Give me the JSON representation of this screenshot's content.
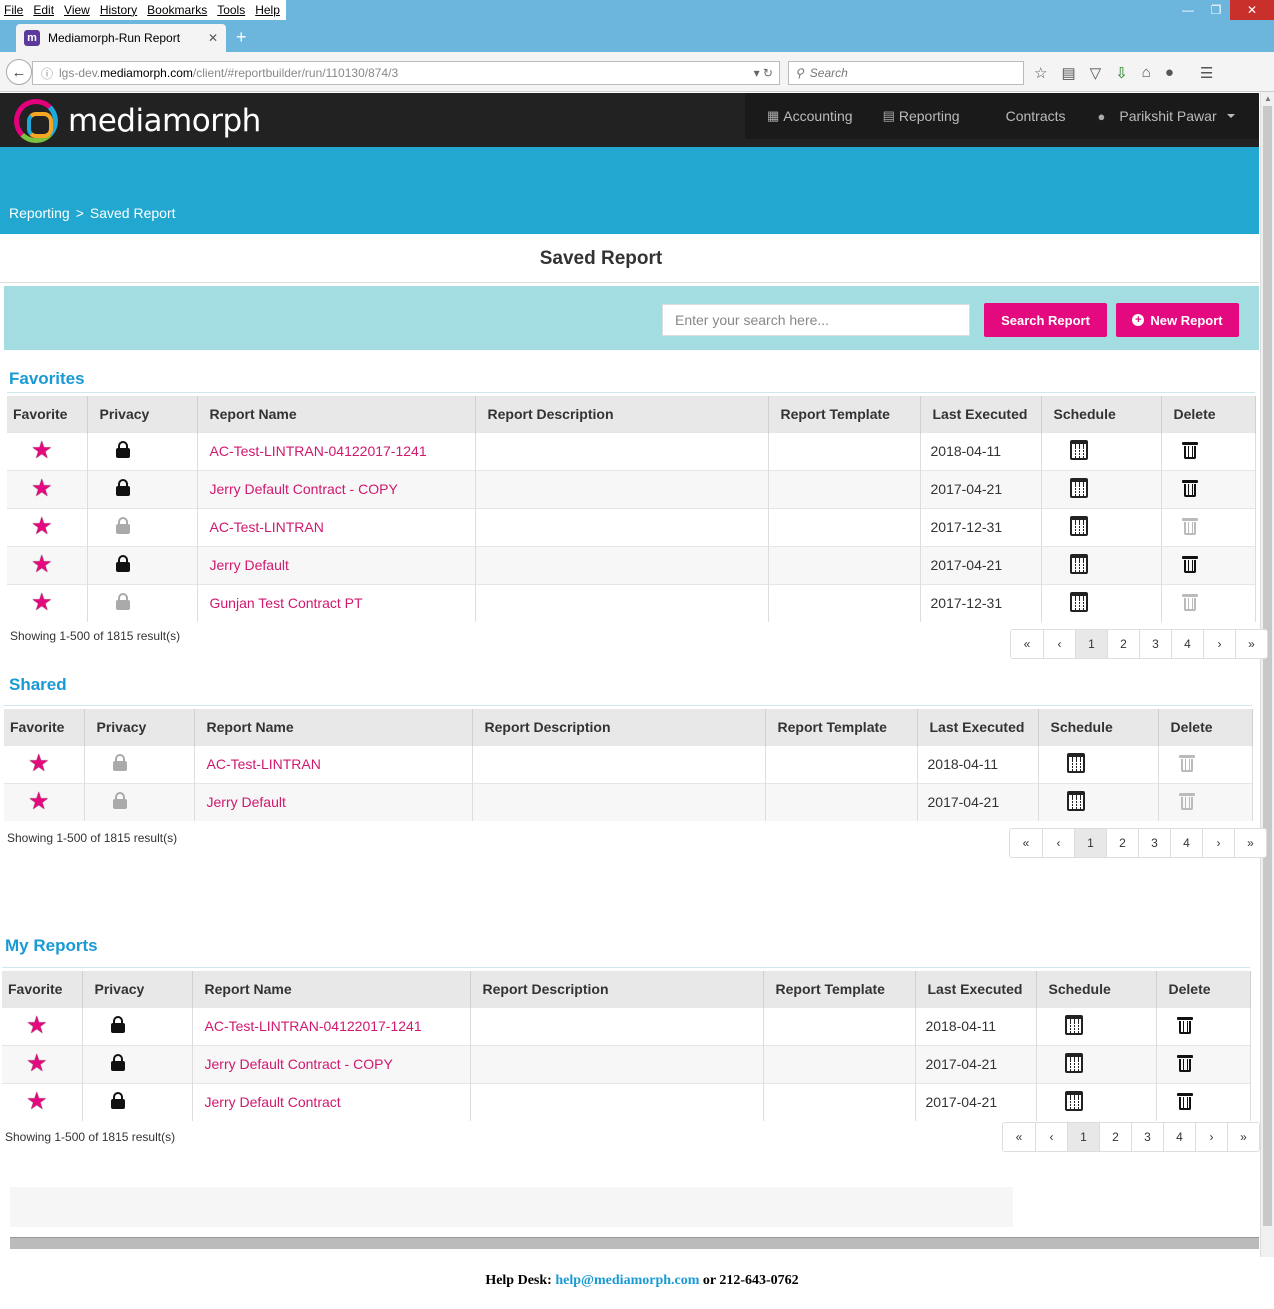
{
  "browser": {
    "menu": [
      "File",
      "Edit",
      "View",
      "History",
      "Bookmarks",
      "Tools",
      "Help"
    ],
    "tab_title": "Mediamorph-Run Report",
    "tab_favicon": "m",
    "url_prefix": "lgs-dev.",
    "url_domain": "mediamorph.com",
    "url_path": "/client/#reportbuilder/run/110130/874/3",
    "search_placeholder": "Search",
    "icons": [
      "back-icon",
      "bookmark-star-icon",
      "reading-list-icon",
      "pocket-icon",
      "download-icon",
      "home-icon",
      "chat-icon",
      "menu-icon"
    ]
  },
  "app": {
    "logo_text": "mediamorph",
    "nav": [
      {
        "label": "Accounting",
        "icon": "grid-icon"
      },
      {
        "label": "Reporting",
        "icon": "newspaper-icon"
      },
      {
        "label": "Contracts",
        "icon": ""
      },
      {
        "label": "Parikshit Pawar",
        "icon": "user-icon"
      }
    ],
    "breadcrumb": {
      "root": "Reporting",
      "sep": ">",
      "current": "Saved Report"
    },
    "page_title": "Saved Report",
    "search_placeholder": "Enter your search here...",
    "search_button": "Search Report",
    "new_button": "New Report",
    "colors": {
      "accent": "#e5097f",
      "band": "#21a7d0",
      "panel": "#a3dde1",
      "heading": "#1a9ad4",
      "link": "#d0186f"
    }
  },
  "columns": [
    "Favorite",
    "Privacy",
    "Report Name",
    "Report Description",
    "Report Template",
    "Last Executed",
    "Schedule",
    "Delete"
  ],
  "sections": [
    {
      "title": "Favorites",
      "rows": [
        {
          "name": "AC-Test-LINTRAN-04122017-1241",
          "locked": true,
          "date": "2018-04-11",
          "deletable": true
        },
        {
          "name": "Jerry Default Contract - COPY",
          "locked": true,
          "date": "2017-04-21",
          "deletable": true
        },
        {
          "name": "AC-Test-LINTRAN",
          "locked": false,
          "date": "2017-12-31",
          "deletable": false
        },
        {
          "name": "Jerry Default",
          "locked": true,
          "date": "2017-04-21",
          "deletable": true
        },
        {
          "name": "Gunjan Test Contract PT",
          "locked": false,
          "date": "2017-12-31",
          "deletable": false
        }
      ],
      "showing": "Showing 1-500 of 1815 result(s)"
    },
    {
      "title": "Shared",
      "rows": [
        {
          "name": "AC-Test-LINTRAN",
          "locked": false,
          "date": "2018-04-11",
          "deletable": false
        },
        {
          "name": "Jerry Default",
          "locked": false,
          "date": "2017-04-21",
          "deletable": false
        }
      ],
      "showing": "Showing 1-500 of 1815 result(s)"
    },
    {
      "title": "My Reports",
      "rows": [
        {
          "name": "AC-Test-LINTRAN-04122017-1241",
          "locked": true,
          "date": "2018-04-11",
          "deletable": true
        },
        {
          "name": "Jerry Default Contract - COPY",
          "locked": true,
          "date": "2017-04-21",
          "deletable": true
        },
        {
          "name": "Jerry Default Contract",
          "locked": true,
          "date": "2017-04-21",
          "deletable": true
        }
      ],
      "showing": "Showing 1-500 of 1815 result(s)"
    }
  ],
  "pagination": [
    "«",
    "‹",
    "1",
    "2",
    "3",
    "4",
    "›",
    "»"
  ],
  "pagination_active": "1",
  "footer": {
    "label": "Help Desk:",
    "email": "help@mediamorph.com",
    "or": "or",
    "phone": "212-643-0762"
  }
}
